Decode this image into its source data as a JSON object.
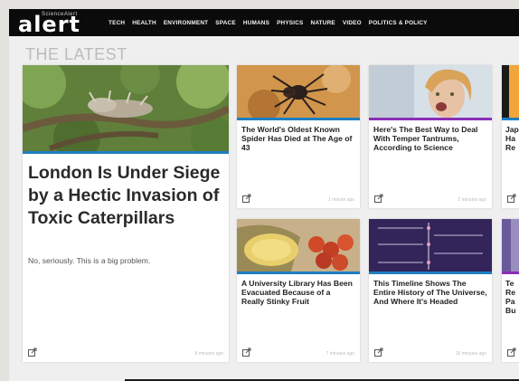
{
  "logo": {
    "main": "alert",
    "small": "ScienceAlert"
  },
  "nav": [
    "TECH",
    "HEALTH",
    "ENVIRONMENT",
    "SPACE",
    "HUMANS",
    "PHYSICS",
    "NATURE",
    "VIDEO",
    "POLITICS & POLICY"
  ],
  "section_title": "THE LATEST",
  "feature": {
    "title": "London Is Under Siege by a Hectic Invasion of Toxic Caterpillars",
    "subtitle": "No, seriously. This is a big problem.",
    "time": "8 minutes ago",
    "stripe_color": "#1d7fc1"
  },
  "cards": [
    {
      "title": "The World's Oldest Known Spider Has Died at The Age of 43",
      "time": "1 minute ago",
      "stripe_color": "#1d7fc1"
    },
    {
      "title": "Here's The Best Way to Deal With Temper Tantrums, According to Science",
      "time": "2 minutes ago",
      "stripe_color": "#8a2fb5"
    },
    {
      "title": "Jap Ha Re",
      "time": "",
      "stripe_color": "#1d7fc1"
    },
    {
      "title": "A University Library Has Been Evacuated Because of a Really Stinky Fruit",
      "time": "7 minutes ago",
      "stripe_color": "#1d7fc1"
    },
    {
      "title": "This Timeline Shows The Entire History of The Universe, And Where It's Headed",
      "time": "16 minutes ago",
      "stripe_color": "#1d7fc1"
    },
    {
      "title": "Te Re Pa Bu",
      "time": "",
      "stripe_color": "#8a2fb5"
    }
  ]
}
